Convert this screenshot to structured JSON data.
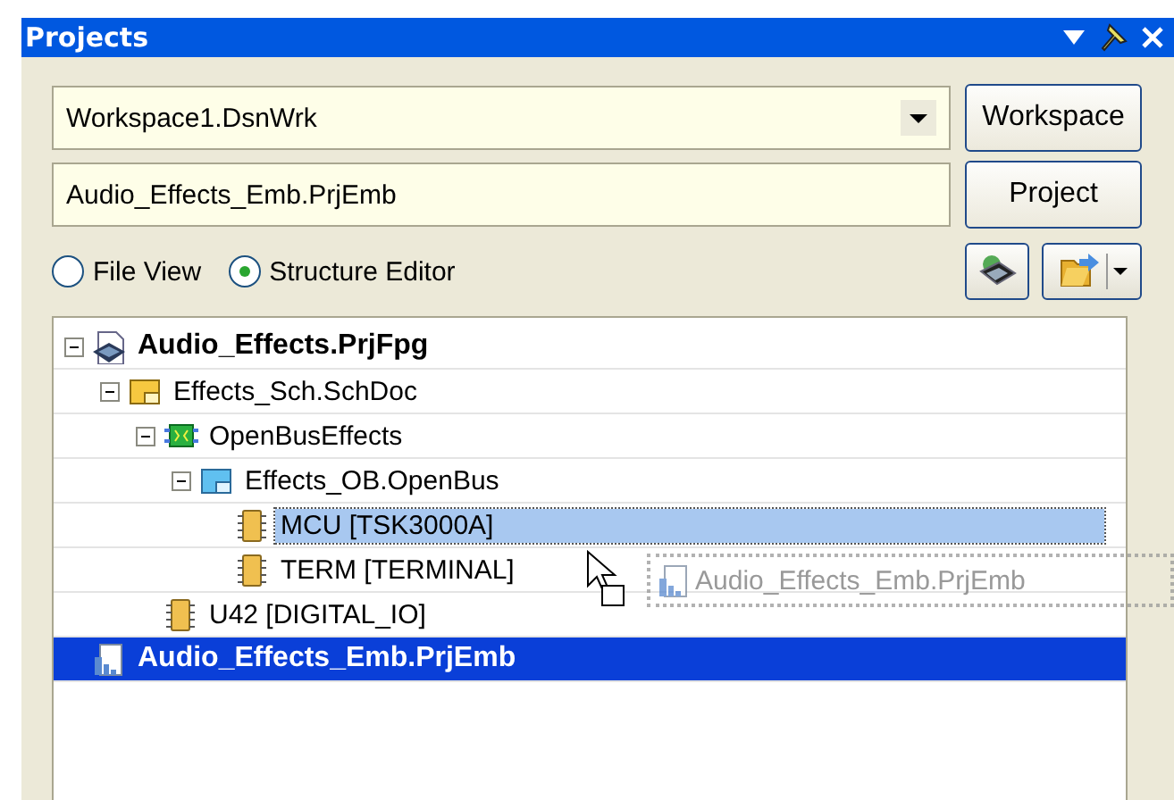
{
  "panel": {
    "title": "Projects"
  },
  "workspace": {
    "value": "Workspace1.DsnWrk",
    "button": "Workspace"
  },
  "project": {
    "value": "Audio_Effects_Emb.PrjEmb",
    "button": "Project"
  },
  "views": [
    {
      "label": "File View",
      "selected": false
    },
    {
      "label": "Structure Editor",
      "selected": true
    }
  ],
  "tree": [
    {
      "label": "Audio_Effects.PrjFpg",
      "kind": "fpga",
      "expanded": true,
      "selected": false,
      "drop_target": false,
      "children": [
        {
          "label": "Effects_Sch.SchDoc",
          "kind": "sheet",
          "expanded": true,
          "selected": false,
          "drop_target": false,
          "children": [
            {
              "label": "OpenBusEffects",
              "kind": "bus",
              "expanded": true,
              "selected": false,
              "drop_target": false,
              "children": [
                {
                  "label": "Effects_OB.OpenBus",
                  "kind": "openbus",
                  "expanded": true,
                  "selected": false,
                  "drop_target": false,
                  "children": [
                    {
                      "label": "MCU [TSK3000A]",
                      "kind": "chip",
                      "selected": false,
                      "drop_target": true
                    },
                    {
                      "label": "TERM [TERMINAL]",
                      "kind": "chip",
                      "selected": false,
                      "drop_target": false
                    }
                  ]
                }
              ]
            },
            {
              "label": "U42 [DIGITAL_IO]",
              "kind": "chip",
              "selected": false,
              "drop_target": false
            }
          ]
        }
      ]
    },
    {
      "label": "Audio_Effects_Emb.PrjEmb",
      "kind": "embedded",
      "selected": true,
      "drop_target": false
    }
  ],
  "drag_ghost": {
    "label": "Audio_Effects_Emb.PrjEmb"
  }
}
